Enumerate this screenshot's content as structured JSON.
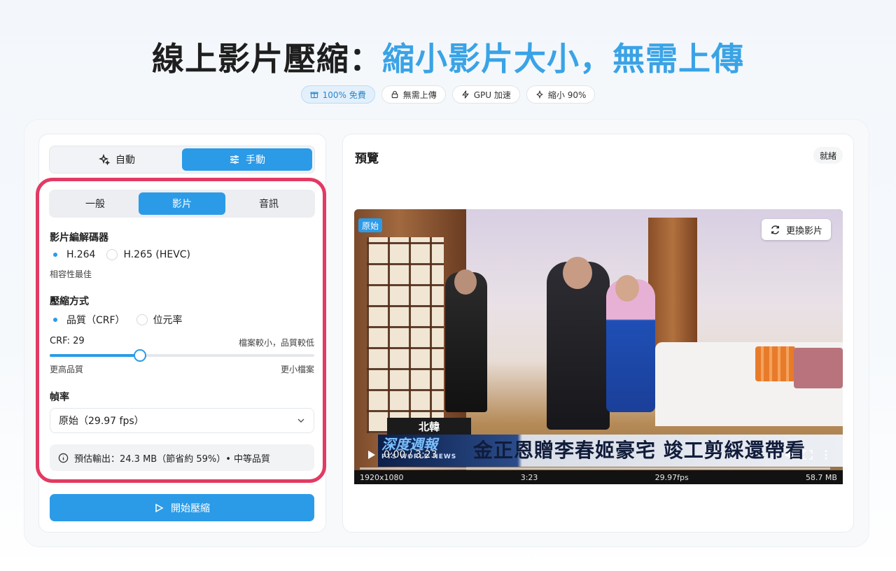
{
  "hero": {
    "title_dark": "線上影片壓縮：",
    "title_blue": "縮小影片大小，無需上傳"
  },
  "badges": [
    {
      "label": "100% 免費",
      "icon": "gift-icon",
      "active": true
    },
    {
      "label": "無需上傳",
      "icon": "lock-icon",
      "active": false
    },
    {
      "label": "GPU 加速",
      "icon": "bolt-icon",
      "active": false
    },
    {
      "label": "縮小 90%",
      "icon": "sparkle-icon",
      "active": false
    }
  ],
  "mode_tabs": {
    "auto": "自動",
    "manual": "手動",
    "selected": "manual"
  },
  "sub_tabs": {
    "general": "一般",
    "video": "影片",
    "audio": "音訊",
    "selected": "video"
  },
  "codec": {
    "title": "影片編解碼器",
    "options": [
      "H.264",
      "H.265 (HEVC)"
    ],
    "selected": "H.264",
    "hint": "相容性最佳"
  },
  "compression": {
    "title": "壓縮方式",
    "options": [
      "品質（CRF）",
      "位元率"
    ],
    "selected": "品質（CRF）",
    "crf_label": "CRF: 29",
    "crf_hint": "檔案較小，品質較低",
    "slider_fraction": 0.34,
    "left_label": "更高品質",
    "right_label": "更小檔案"
  },
  "framerate": {
    "title": "幀率",
    "value": "原始（29.97 fps）"
  },
  "estimate": "預估輸出：24.3 MB（節省約 59%）• 中等品質",
  "start_button": "開始壓縮",
  "preview": {
    "title": "預覽",
    "status": "就緒",
    "original_badge": "原始",
    "replace_button": "更換影片",
    "news_tag": "北韓",
    "news_logo_main": "深度週報",
    "news_logo_sub": "PTS WORLD NEWS",
    "news_headline": "金正恩贈李春姬豪宅 竣工剪綵還帶看",
    "time": "0:00 / 3:23",
    "meta": {
      "resolution": "1920x1080",
      "duration": "3:23",
      "fps": "29.97fps",
      "size": "58.7 MB"
    }
  },
  "colors": {
    "accent": "#2b9be8",
    "highlight_frame": "#e23a63",
    "title_blue": "#3aa3e6"
  }
}
